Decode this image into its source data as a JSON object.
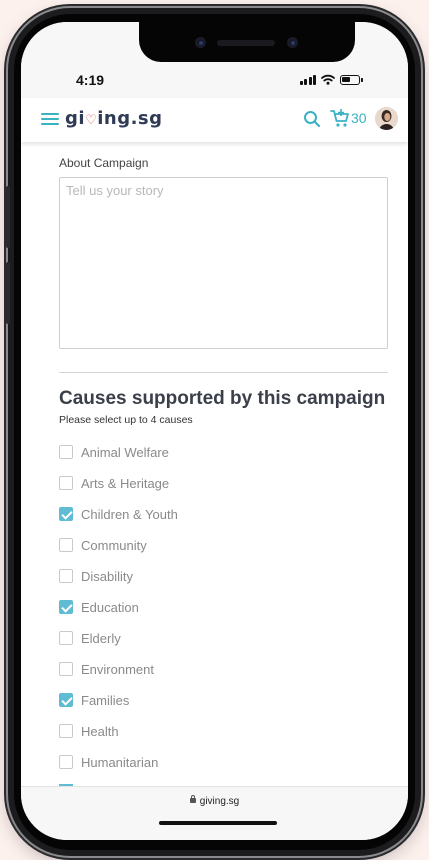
{
  "status_bar": {
    "time": "4:19"
  },
  "header": {
    "logo_prefix": "gi",
    "logo_heart": "♡",
    "logo_suffix": "ing.sg",
    "cart_count": "30",
    "icons": [
      "menu-icon",
      "search-icon",
      "cart-icon",
      "avatar"
    ]
  },
  "about": {
    "label": "About Campaign",
    "placeholder": "Tell us your story"
  },
  "causes_section": {
    "title": "Causes supported by this campaign",
    "subtitle": "Please select up to 4 causes",
    "items": [
      {
        "label": "Animal Welfare",
        "checked": false
      },
      {
        "label": "Arts & Heritage",
        "checked": false
      },
      {
        "label": "Children & Youth",
        "checked": true
      },
      {
        "label": "Community",
        "checked": false
      },
      {
        "label": "Disability",
        "checked": false
      },
      {
        "label": "Education",
        "checked": true
      },
      {
        "label": "Elderly",
        "checked": false
      },
      {
        "label": "Environment",
        "checked": false
      },
      {
        "label": "Families",
        "checked": true
      },
      {
        "label": "Health",
        "checked": false
      },
      {
        "label": "Humanitarian",
        "checked": false
      }
    ]
  },
  "browser": {
    "url": "giving.sg"
  },
  "colors": {
    "accent": "#3bb1c4",
    "checkbox": "#5fbcd3",
    "background": "#fdf1ee",
    "heart": "#e8505b"
  }
}
